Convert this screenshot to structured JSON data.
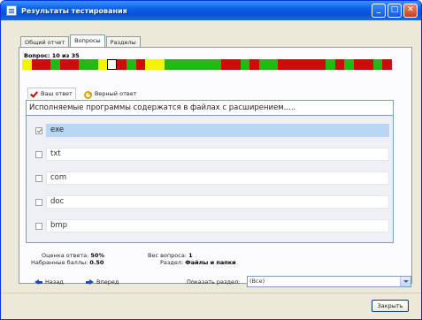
{
  "window": {
    "title": "Результаты тестирования"
  },
  "tabs": [
    {
      "label": "Общий отчет",
      "active": false
    },
    {
      "label": "Вопросы",
      "active": true
    },
    {
      "label": "Разделы",
      "active": false
    }
  ],
  "question_header": "Вопрос: 10 из 35",
  "progress_cells": [
    "y",
    "r",
    "r",
    "g",
    "r",
    "r",
    "g",
    "g",
    "y",
    "cur",
    "r",
    "g",
    "r",
    "y",
    "y",
    "g",
    "g",
    "g",
    "g",
    "g",
    "g",
    "r",
    "r",
    "g",
    "r",
    "g",
    "g",
    "r",
    "r",
    "r",
    "r",
    "r",
    "g",
    "r",
    "g",
    "r",
    "r",
    "g",
    "r"
  ],
  "answer_tabs": [
    {
      "label": "Ваш ответ",
      "icon": "check-icon",
      "active": true
    },
    {
      "label": "Верный ответ",
      "icon": "key-icon",
      "active": false
    }
  ],
  "question_text": "Исполняемые программы содержатся в файлах с расширением.....",
  "options": [
    {
      "label": "exe",
      "checked": true,
      "selected": true
    },
    {
      "label": "txt",
      "checked": false,
      "selected": false
    },
    {
      "label": "com",
      "checked": false,
      "selected": false
    },
    {
      "label": "doc",
      "checked": false,
      "selected": false
    },
    {
      "label": "bmp",
      "checked": false,
      "selected": false
    }
  ],
  "stats": {
    "answer_score_label": "Оценка ответа:",
    "answer_score_value": "50%",
    "points_label": "Набранные баллы:",
    "points_value": "0.50",
    "weight_label": "Вес вопроса:",
    "weight_value": "1",
    "section_label": "Раздел:",
    "section_value": "Файлы и папки"
  },
  "nav": {
    "back_label": "Назад",
    "forward_label": "Вперед"
  },
  "section_filter": {
    "label": "Показать раздел:",
    "value": "(Все)"
  },
  "close_button": "Закрыть",
  "colors": {
    "correct": "#26b812",
    "wrong": "#d10a0a",
    "partial": "#f3f400",
    "selection": "#b9d6f6"
  }
}
